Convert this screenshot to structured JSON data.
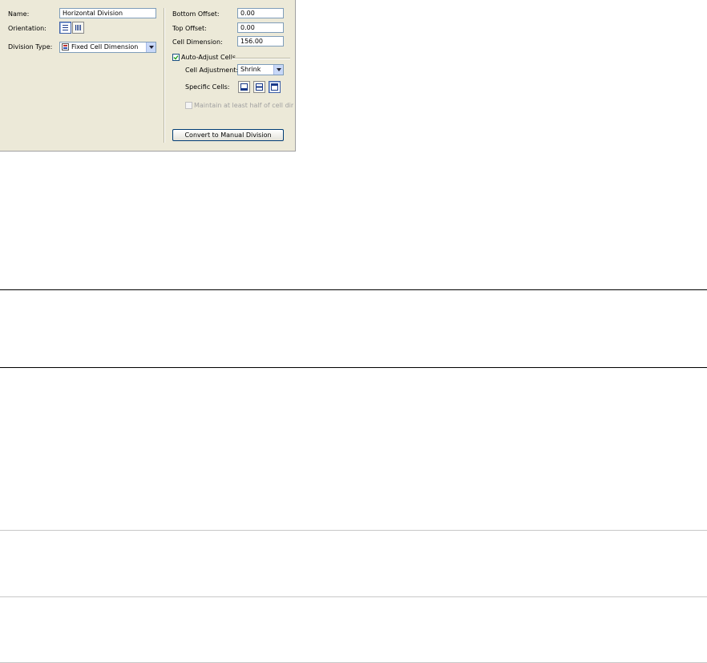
{
  "left": {
    "name_label": "Name:",
    "name_value": "Horizontal Division",
    "orientation_label": "Orientation:",
    "division_type_label": "Division Type:",
    "division_type_value": "Fixed Cell Dimension"
  },
  "right": {
    "bottom_offset_label": "Bottom Offset:",
    "bottom_offset_value": "0.00",
    "top_offset_label": "Top Offset:",
    "top_offset_value": "0.00",
    "cell_dimension_label": "Cell Dimension:",
    "cell_dimension_value": "156.00",
    "auto_adjust_label": "Auto-Adjust Cells",
    "cell_adjustment_label": "Cell Adjustment:",
    "cell_adjustment_value": "Shrink",
    "specific_cells_label": "Specific Cells:",
    "maintain_label": "Maintain at least half of cell dimension",
    "convert_button": "Convert to Manual Division"
  },
  "colors": {
    "panel_bg": "#ece9d8",
    "input_border": "#7f9db9",
    "button_border": "#003c74"
  }
}
